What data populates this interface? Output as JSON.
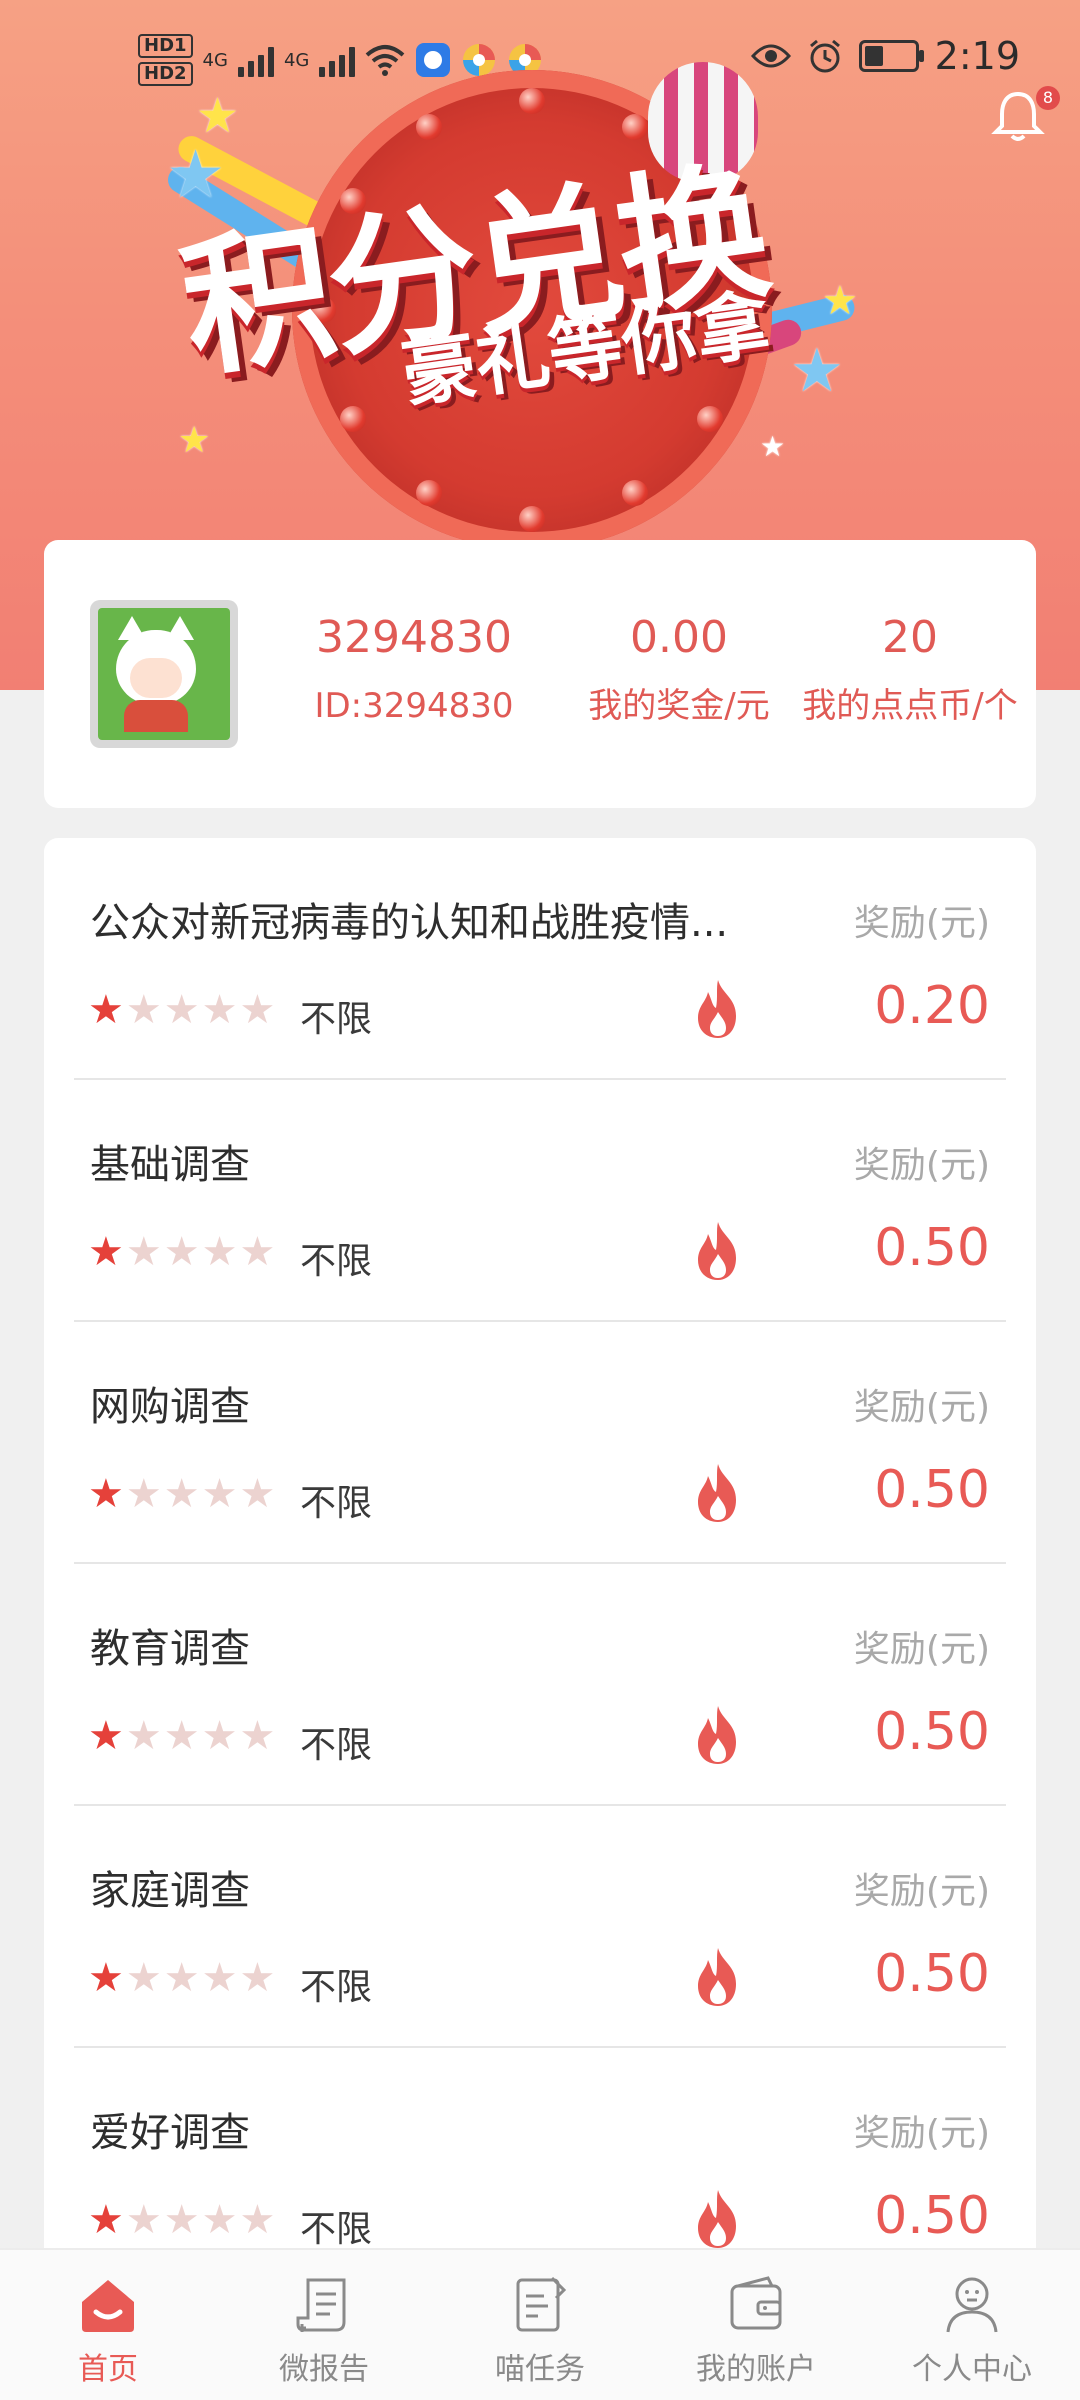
{
  "status_bar": {
    "hd1": "HD1",
    "hd2": "HD2",
    "net1": "4G",
    "net2": "4G",
    "time": "2:19"
  },
  "notifications": {
    "count": "8"
  },
  "banner": {
    "title": "积分兑换",
    "subtitle": "豪礼等你拿"
  },
  "profile": {
    "username": "3294830",
    "user_id": "ID:3294830",
    "bonus_value": "0.00",
    "bonus_label": "我的奖金/元",
    "coins_value": "20",
    "coins_label": "我的点点币/个"
  },
  "surveys": [
    {
      "title": "公众对新冠病毒的认知和战胜疫情...",
      "reward_label": "奖励(元)",
      "limit": "不限",
      "stars": 1,
      "amount": "0.20"
    },
    {
      "title": "基础调查",
      "reward_label": "奖励(元)",
      "limit": "不限",
      "stars": 1,
      "amount": "0.50"
    },
    {
      "title": "网购调查",
      "reward_label": "奖励(元)",
      "limit": "不限",
      "stars": 1,
      "amount": "0.50"
    },
    {
      "title": "教育调查",
      "reward_label": "奖励(元)",
      "limit": "不限",
      "stars": 1,
      "amount": "0.50"
    },
    {
      "title": "家庭调查",
      "reward_label": "奖励(元)",
      "limit": "不限",
      "stars": 1,
      "amount": "0.50"
    },
    {
      "title": "爱好调查",
      "reward_label": "奖励(元)",
      "limit": "不限",
      "stars": 1,
      "amount": "0.50"
    }
  ],
  "nav": [
    {
      "label": "首页",
      "icon": "home-icon",
      "active": true
    },
    {
      "label": "微报告",
      "icon": "report-icon",
      "active": false
    },
    {
      "label": "喵任务",
      "icon": "task-icon",
      "active": false
    },
    {
      "label": "我的账户",
      "icon": "wallet-icon",
      "active": false
    },
    {
      "label": "个人中心",
      "icon": "user-icon",
      "active": false
    }
  ],
  "colors": {
    "accent": "#e85a55",
    "banner_top": "#f6a184",
    "banner_bottom": "#f27f73",
    "star_on": "#e5413a",
    "star_off": "#ecd3d0"
  }
}
